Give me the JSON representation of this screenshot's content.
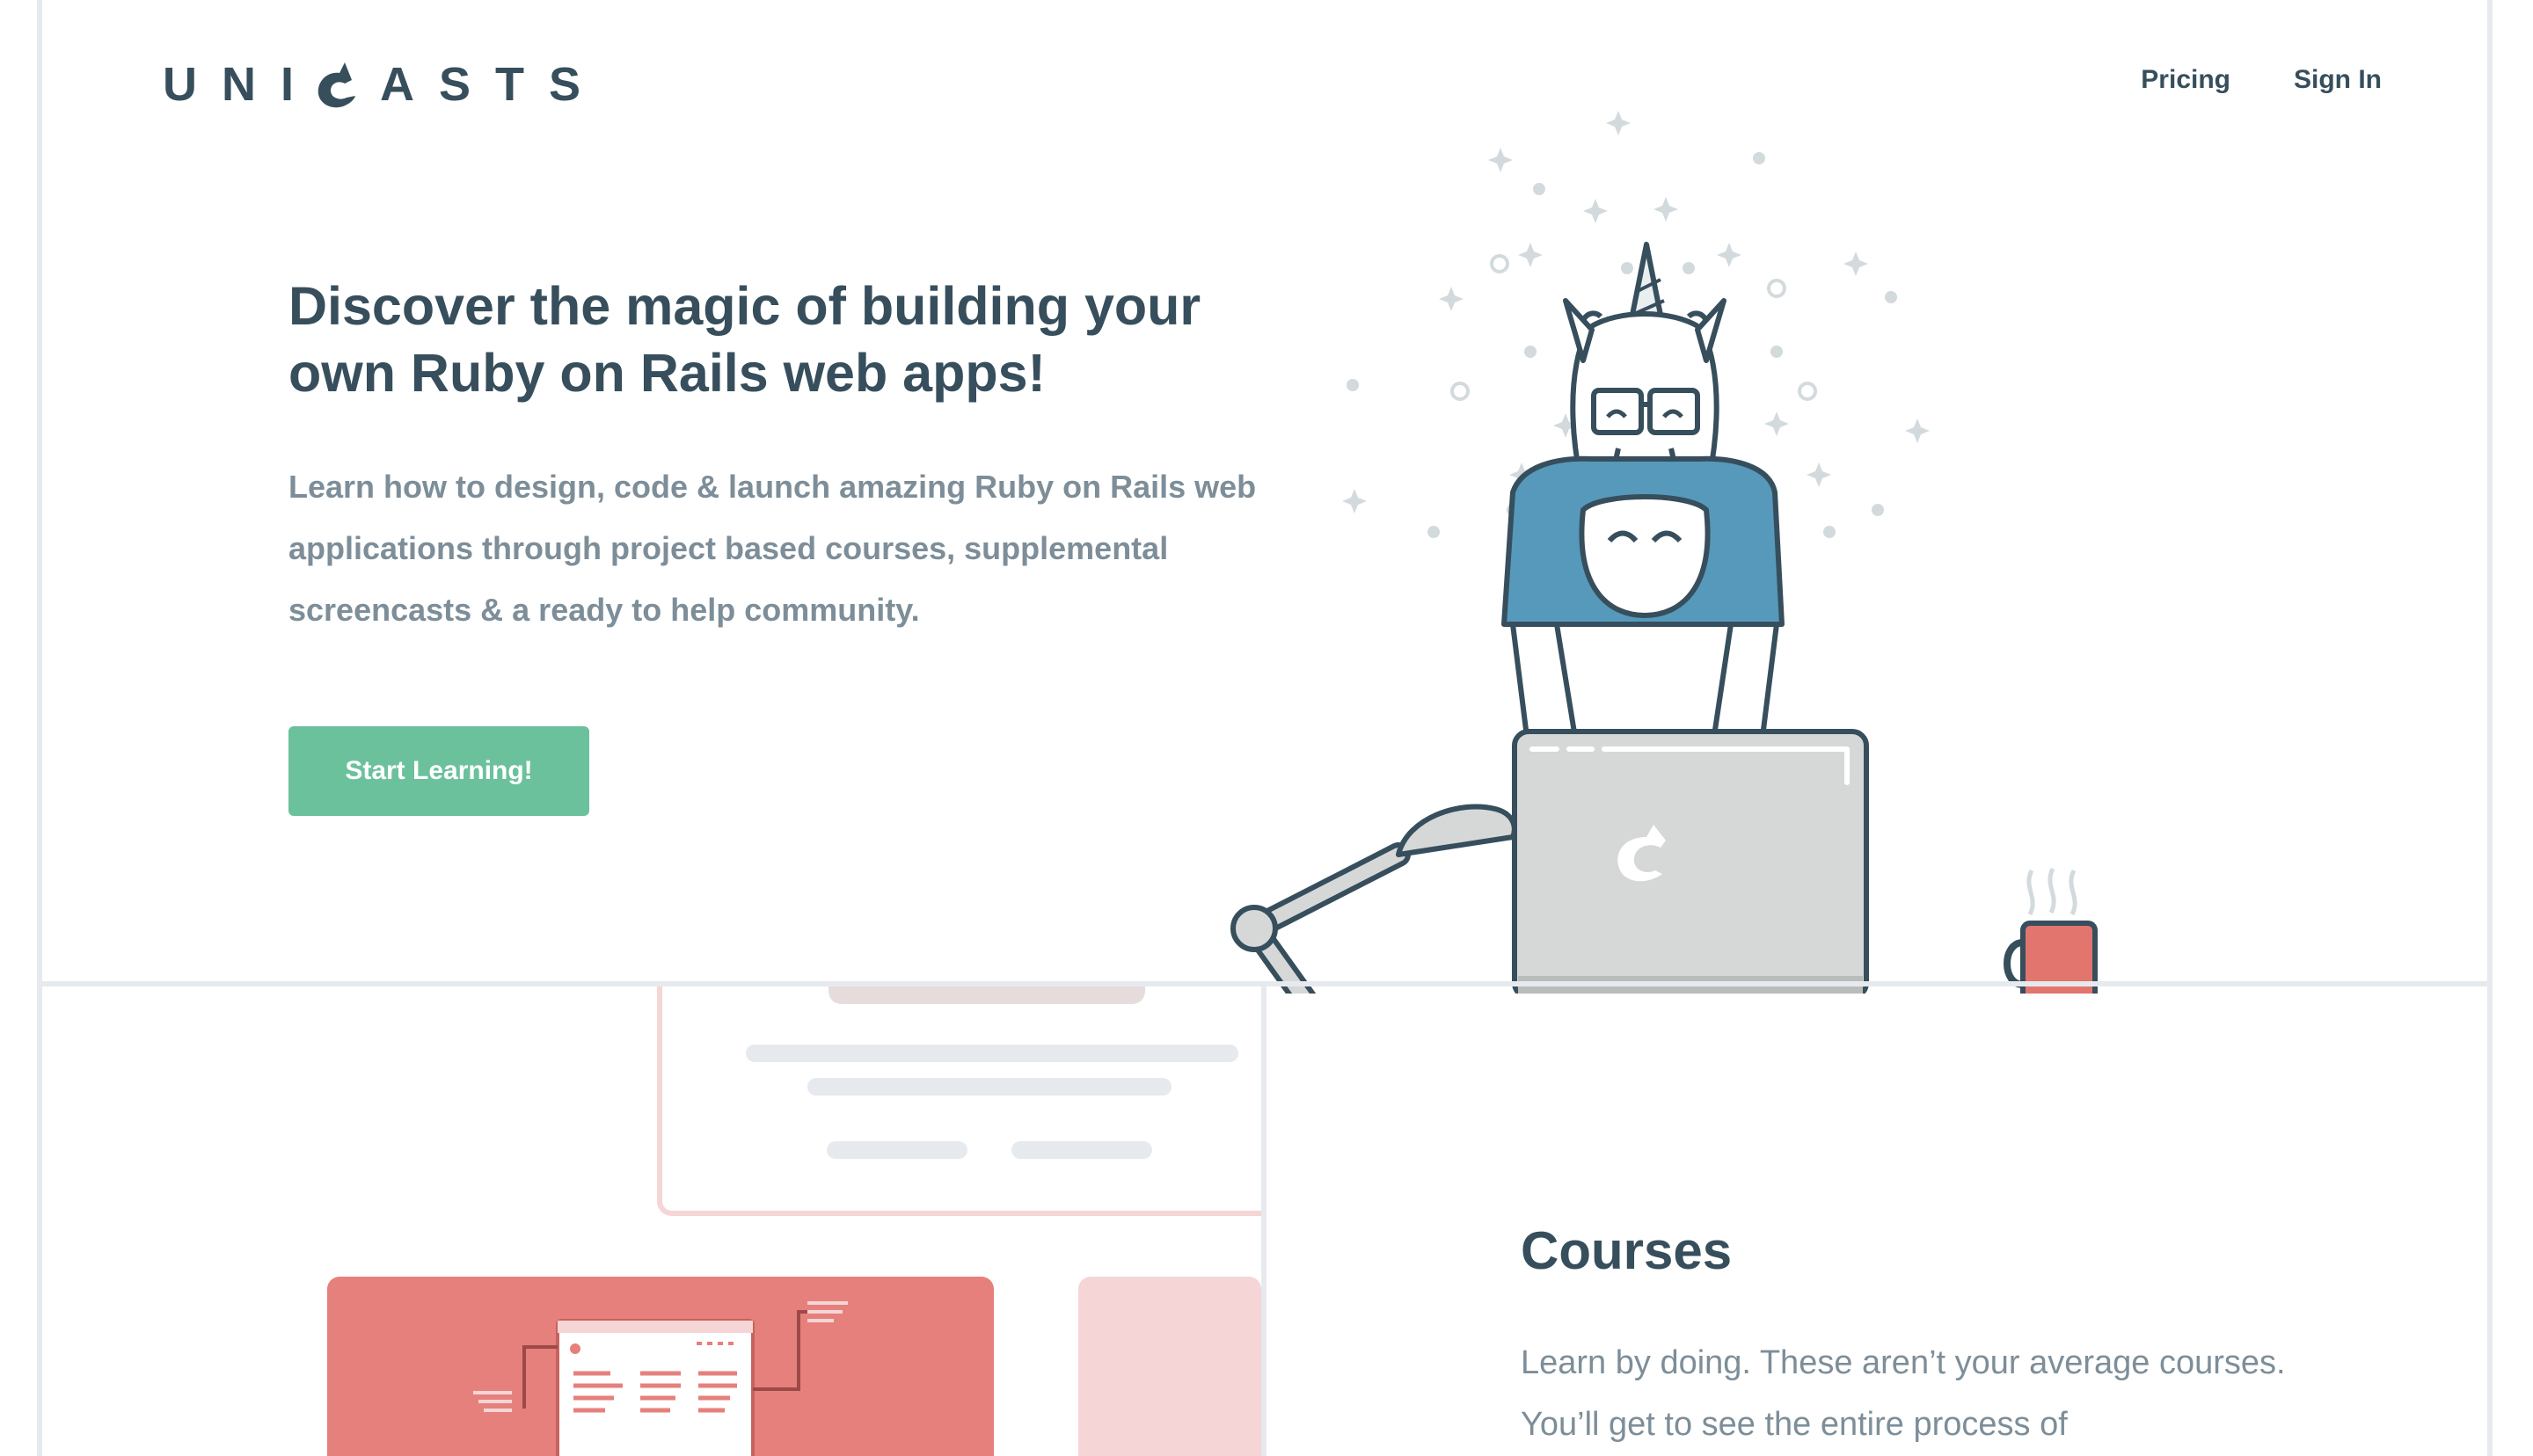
{
  "brand": {
    "logo_text_left": "UNI",
    "logo_text_right": "ASTS",
    "logo_icon": "unicorn-c-icon"
  },
  "nav": {
    "pricing_label": "Pricing",
    "signin_label": "Sign In"
  },
  "hero": {
    "title": "Discover the magic of building your own Ruby on Rails web apps!",
    "subtitle": "Learn how to design, code & launch amazing Ruby on Rails web applications through project based courses, supplemental screencasts & a ready to help community.",
    "cta_label": "Start Learning!"
  },
  "courses": {
    "title": "Courses",
    "body": "Learn by doing. These aren’t your average courses. You’ll get to see the entire process of"
  },
  "colors": {
    "heading": "#374e5c",
    "body_text": "#7d8e99",
    "cta": "#6cc19d",
    "sweater": "#5699bb",
    "mug": "#e2756e",
    "laptop": "#d6d8d7",
    "card_red": "#e6807c",
    "card_pink": "#f5d5d5"
  }
}
